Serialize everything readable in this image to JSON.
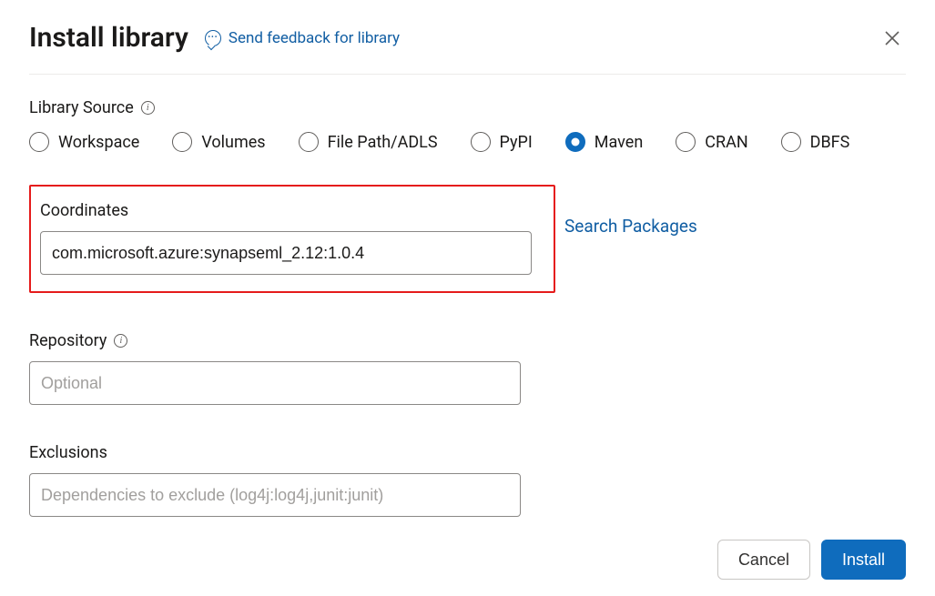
{
  "header": {
    "title": "Install library",
    "feedback_label": "Send feedback for library"
  },
  "library_source": {
    "label": "Library Source",
    "options": [
      {
        "label": "Workspace",
        "selected": false
      },
      {
        "label": "Volumes",
        "selected": false
      },
      {
        "label": "File Path/ADLS",
        "selected": false
      },
      {
        "label": "PyPI",
        "selected": false
      },
      {
        "label": "Maven",
        "selected": true
      },
      {
        "label": "CRAN",
        "selected": false
      },
      {
        "label": "DBFS",
        "selected": false
      }
    ]
  },
  "coordinates": {
    "label": "Coordinates",
    "value": "com.microsoft.azure:synapseml_2.12:1.0.4",
    "search_link": "Search Packages"
  },
  "repository": {
    "label": "Repository",
    "placeholder": "Optional",
    "value": ""
  },
  "exclusions": {
    "label": "Exclusions",
    "placeholder": "Dependencies to exclude (log4j:log4j,junit:junit)",
    "value": ""
  },
  "footer": {
    "cancel": "Cancel",
    "install": "Install"
  }
}
